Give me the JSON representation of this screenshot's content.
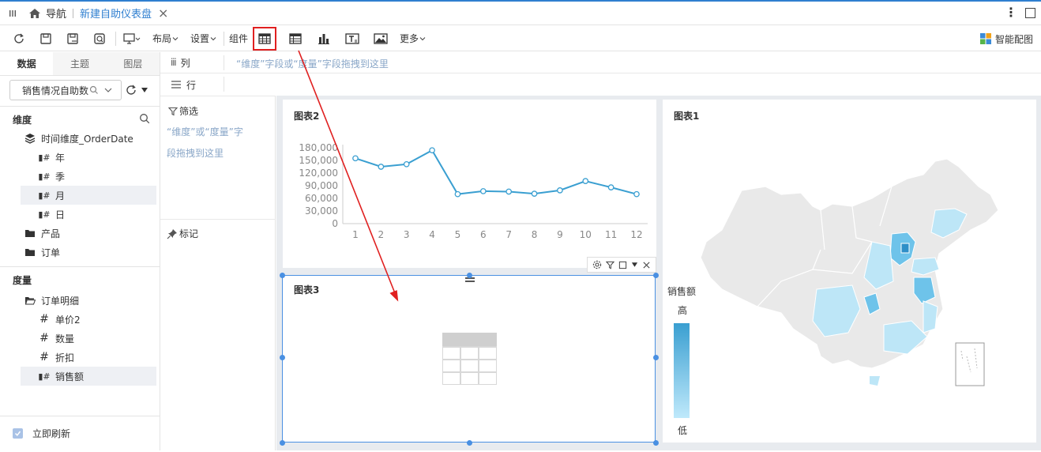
{
  "titlebar": {
    "menu_icon": "grid-menu-icon",
    "home_label": "导航",
    "tab_label": "新建自助仪表盘",
    "close": "×",
    "more": "⋮"
  },
  "toolbar": {
    "layout_label": "布局",
    "settings_label": "设置",
    "components_label": "组件",
    "more_label": "更多",
    "smart_chart_label": "智能配图"
  },
  "left": {
    "tabs": [
      "数据",
      "主题",
      "图层"
    ],
    "dataset_value": "销售情况自助数",
    "dimensions_title": "维度",
    "dimensions": {
      "time_dim": "时间维度_OrderDate",
      "year": "年",
      "season": "季",
      "month": "月",
      "day": "日",
      "product": "产品",
      "order": "订单"
    },
    "measures_title": "度量",
    "measures": {
      "folder": "订单明细",
      "price": "单价2",
      "qty": "数量",
      "discount": "折扣",
      "sales": "销售额"
    },
    "refresh_label": "立即刷新"
  },
  "mid": {
    "filter_label": "筛选",
    "filter_hint": "“维度”或“度量”字段拖拽到这里",
    "filter_hint_line1": "“维度”或“度量”字",
    "filter_hint_line2": "段拖拽到这里",
    "mark_label": "标记"
  },
  "rowcol": {
    "col_label": "列",
    "col_hint": "“维度”字段或“度量”字段拖拽到这里",
    "row_label": "行"
  },
  "charts": {
    "chart2_title": "图表2",
    "chart3_title": "图表3",
    "chart1_title": "图表1",
    "legend_title": "销售额",
    "legend_high": "高",
    "legend_low": "低"
  },
  "chart_data": {
    "type": "line",
    "title": "图表2",
    "categories": [
      "1",
      "2",
      "3",
      "4",
      "5",
      "6",
      "7",
      "8",
      "9",
      "10",
      "11",
      "12"
    ],
    "values": [
      155000,
      135000,
      141000,
      174000,
      70000,
      77000,
      76000,
      71000,
      79000,
      101000,
      86000,
      70000
    ],
    "y_ticks": [
      "0",
      "30,000",
      "60,000",
      "90,000",
      "120,000",
      "150,000",
      "180,000"
    ],
    "ylim": [
      0,
      180000
    ],
    "color": "#3a9fd1"
  },
  "colors": {
    "accent": "#2f7fd0",
    "highlight_red": "#e02020",
    "selection_blue": "#4a90e2",
    "map_base": "#e9e9e9",
    "map_light": "#bde6f7",
    "map_mid": "#6ec3ea",
    "map_dark": "#2e8fc8"
  }
}
